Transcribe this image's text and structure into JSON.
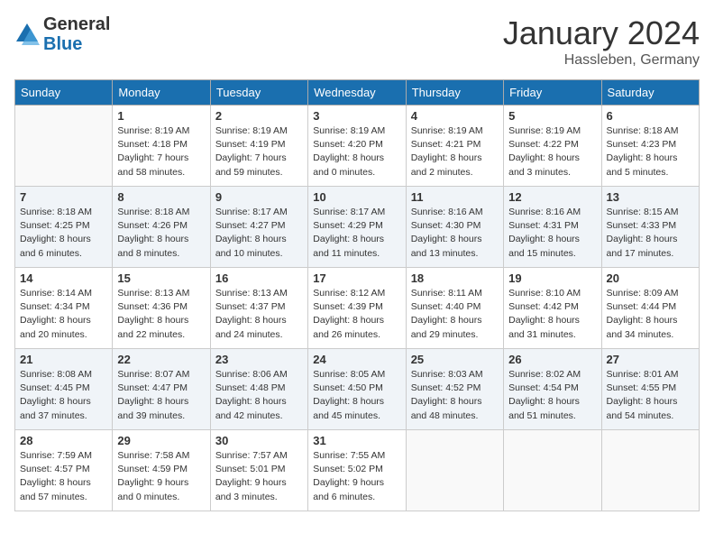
{
  "header": {
    "logo_general": "General",
    "logo_blue": "Blue",
    "month": "January 2024",
    "location": "Hassleben, Germany"
  },
  "weekdays": [
    "Sunday",
    "Monday",
    "Tuesday",
    "Wednesday",
    "Thursday",
    "Friday",
    "Saturday"
  ],
  "weeks": [
    [
      {
        "day": "",
        "info": ""
      },
      {
        "day": "1",
        "info": "Sunrise: 8:19 AM\nSunset: 4:18 PM\nDaylight: 7 hours\nand 58 minutes."
      },
      {
        "day": "2",
        "info": "Sunrise: 8:19 AM\nSunset: 4:19 PM\nDaylight: 7 hours\nand 59 minutes."
      },
      {
        "day": "3",
        "info": "Sunrise: 8:19 AM\nSunset: 4:20 PM\nDaylight: 8 hours\nand 0 minutes."
      },
      {
        "day": "4",
        "info": "Sunrise: 8:19 AM\nSunset: 4:21 PM\nDaylight: 8 hours\nand 2 minutes."
      },
      {
        "day": "5",
        "info": "Sunrise: 8:19 AM\nSunset: 4:22 PM\nDaylight: 8 hours\nand 3 minutes."
      },
      {
        "day": "6",
        "info": "Sunrise: 8:18 AM\nSunset: 4:23 PM\nDaylight: 8 hours\nand 5 minutes."
      }
    ],
    [
      {
        "day": "7",
        "info": "Sunrise: 8:18 AM\nSunset: 4:25 PM\nDaylight: 8 hours\nand 6 minutes."
      },
      {
        "day": "8",
        "info": "Sunrise: 8:18 AM\nSunset: 4:26 PM\nDaylight: 8 hours\nand 8 minutes."
      },
      {
        "day": "9",
        "info": "Sunrise: 8:17 AM\nSunset: 4:27 PM\nDaylight: 8 hours\nand 10 minutes."
      },
      {
        "day": "10",
        "info": "Sunrise: 8:17 AM\nSunset: 4:29 PM\nDaylight: 8 hours\nand 11 minutes."
      },
      {
        "day": "11",
        "info": "Sunrise: 8:16 AM\nSunset: 4:30 PM\nDaylight: 8 hours\nand 13 minutes."
      },
      {
        "day": "12",
        "info": "Sunrise: 8:16 AM\nSunset: 4:31 PM\nDaylight: 8 hours\nand 15 minutes."
      },
      {
        "day": "13",
        "info": "Sunrise: 8:15 AM\nSunset: 4:33 PM\nDaylight: 8 hours\nand 17 minutes."
      }
    ],
    [
      {
        "day": "14",
        "info": "Sunrise: 8:14 AM\nSunset: 4:34 PM\nDaylight: 8 hours\nand 20 minutes."
      },
      {
        "day": "15",
        "info": "Sunrise: 8:13 AM\nSunset: 4:36 PM\nDaylight: 8 hours\nand 22 minutes."
      },
      {
        "day": "16",
        "info": "Sunrise: 8:13 AM\nSunset: 4:37 PM\nDaylight: 8 hours\nand 24 minutes."
      },
      {
        "day": "17",
        "info": "Sunrise: 8:12 AM\nSunset: 4:39 PM\nDaylight: 8 hours\nand 26 minutes."
      },
      {
        "day": "18",
        "info": "Sunrise: 8:11 AM\nSunset: 4:40 PM\nDaylight: 8 hours\nand 29 minutes."
      },
      {
        "day": "19",
        "info": "Sunrise: 8:10 AM\nSunset: 4:42 PM\nDaylight: 8 hours\nand 31 minutes."
      },
      {
        "day": "20",
        "info": "Sunrise: 8:09 AM\nSunset: 4:44 PM\nDaylight: 8 hours\nand 34 minutes."
      }
    ],
    [
      {
        "day": "21",
        "info": "Sunrise: 8:08 AM\nSunset: 4:45 PM\nDaylight: 8 hours\nand 37 minutes."
      },
      {
        "day": "22",
        "info": "Sunrise: 8:07 AM\nSunset: 4:47 PM\nDaylight: 8 hours\nand 39 minutes."
      },
      {
        "day": "23",
        "info": "Sunrise: 8:06 AM\nSunset: 4:48 PM\nDaylight: 8 hours\nand 42 minutes."
      },
      {
        "day": "24",
        "info": "Sunrise: 8:05 AM\nSunset: 4:50 PM\nDaylight: 8 hours\nand 45 minutes."
      },
      {
        "day": "25",
        "info": "Sunrise: 8:03 AM\nSunset: 4:52 PM\nDaylight: 8 hours\nand 48 minutes."
      },
      {
        "day": "26",
        "info": "Sunrise: 8:02 AM\nSunset: 4:54 PM\nDaylight: 8 hours\nand 51 minutes."
      },
      {
        "day": "27",
        "info": "Sunrise: 8:01 AM\nSunset: 4:55 PM\nDaylight: 8 hours\nand 54 minutes."
      }
    ],
    [
      {
        "day": "28",
        "info": "Sunrise: 7:59 AM\nSunset: 4:57 PM\nDaylight: 8 hours\nand 57 minutes."
      },
      {
        "day": "29",
        "info": "Sunrise: 7:58 AM\nSunset: 4:59 PM\nDaylight: 9 hours\nand 0 minutes."
      },
      {
        "day": "30",
        "info": "Sunrise: 7:57 AM\nSunset: 5:01 PM\nDaylight: 9 hours\nand 3 minutes."
      },
      {
        "day": "31",
        "info": "Sunrise: 7:55 AM\nSunset: 5:02 PM\nDaylight: 9 hours\nand 6 minutes."
      },
      {
        "day": "",
        "info": ""
      },
      {
        "day": "",
        "info": ""
      },
      {
        "day": "",
        "info": ""
      }
    ]
  ]
}
